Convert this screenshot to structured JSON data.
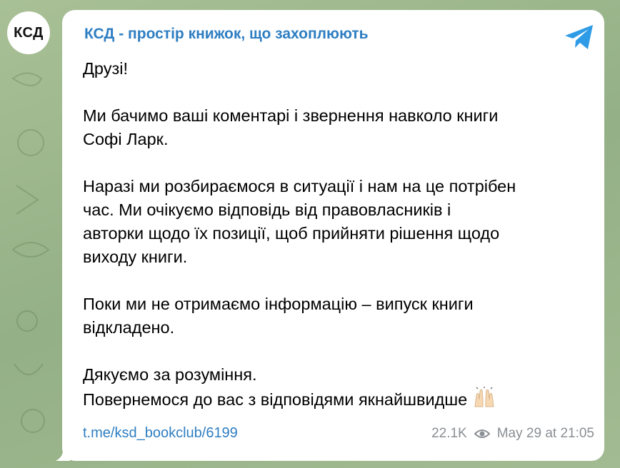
{
  "avatar": {
    "text": "КСД"
  },
  "post": {
    "channel_name": "КСД - простір книжок, що захоплюють",
    "paragraphs": [
      [
        "Друзі!"
      ],
      [
        "Ми бачимо ваші коментарі і звернення навколо книги",
        "Софі Ларк."
      ],
      [
        "Наразі ми розбираємося в ситуації і нам на це потрібен",
        "час. Ми очікуємо відповідь від правовласників і",
        "авторки щодо їх позиції, щоб прийняти рішення щодо",
        "виходу книги."
      ],
      [
        "Поки ми не отримаємо інформацію – випуск книги",
        "відкладено."
      ],
      [
        "Дякуємо за розуміння.",
        "Повернемося до вас з відповідями якнайшвидше"
      ]
    ],
    "link": "t.me/ksd_bookclub/6199",
    "views": "22.1K",
    "timestamp": "May 29 at 21:05"
  },
  "icons": {
    "share": "telegram-share-icon",
    "views": "eye-icon",
    "emoji": "raised-hands-emoji"
  },
  "colors": {
    "accent": "#2e7ec2",
    "meta": "#8a8f94",
    "background": "#9cb58e"
  }
}
